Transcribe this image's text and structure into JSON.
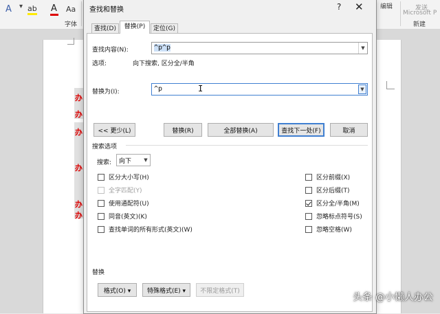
{
  "background": {
    "ribbon": {
      "font_group_label": "字体",
      "edit_group_label": "编辑",
      "new_group_label": "新建",
      "ms_label_line1": "发送",
      "ms_label_line2": "Microsoft P",
      "font_glyph_a": "A",
      "font_glyph_a2": "Aa",
      "font_color_a": "A",
      "highlight_glyph": "ab",
      "shrink_glyph": "A"
    },
    "doc_chars": [
      "办",
      "办",
      "办",
      "办",
      "办",
      "办"
    ]
  },
  "dialog": {
    "title": "查找和替换",
    "help_label": "?",
    "close_label": "✕",
    "tabs": [
      {
        "label": "查找(D)",
        "active": false
      },
      {
        "label": "替换(P)",
        "active": true
      },
      {
        "label": "定位(G)",
        "active": false
      }
    ],
    "find": {
      "label": "查找内容(N):",
      "value": "^p^p",
      "options_label": "选项:",
      "options_value": "向下搜索, 区分全/半角"
    },
    "replace": {
      "label": "替换为(I):",
      "value": "^p"
    },
    "buttons": {
      "less": "<< 更少(L)",
      "replace": "替换(R)",
      "replace_all": "全部替换(A)",
      "find_next": "查找下一处(F)",
      "cancel": "取消"
    },
    "search_options": {
      "section_title": "搜索选项",
      "search_label": "搜索:",
      "search_value": "向下",
      "left_checks": [
        {
          "label": "区分大小写(H)",
          "checked": false,
          "disabled": false
        },
        {
          "label": "全字匹配(Y)",
          "checked": false,
          "disabled": true
        },
        {
          "label": "使用通配符(U)",
          "checked": false,
          "disabled": false
        },
        {
          "label": "同音(英文)(K)",
          "checked": false,
          "disabled": false
        },
        {
          "label": "查找单词的所有形式(英文)(W)",
          "checked": false,
          "disabled": false
        }
      ],
      "right_checks": [
        {
          "label": "区分前缀(X)",
          "checked": false,
          "disabled": false
        },
        {
          "label": "区分后缀(T)",
          "checked": false,
          "disabled": false
        },
        {
          "label": "区分全/半角(M)",
          "checked": true,
          "disabled": false
        },
        {
          "label": "忽略标点符号(S)",
          "checked": false,
          "disabled": false
        },
        {
          "label": "忽略空格(W)",
          "checked": false,
          "disabled": false
        }
      ]
    },
    "replace_section": {
      "title": "替换",
      "format_button": "格式(O) ▾",
      "special_button": "特殊格式(E) ▾",
      "no_format_button": "不限定格式(T)"
    }
  },
  "watermark": "头条 @小懒人办公",
  "colors": {
    "accent": "#3f7fd1",
    "doc_red": "#dd0000",
    "selection": "#cce0f7"
  }
}
